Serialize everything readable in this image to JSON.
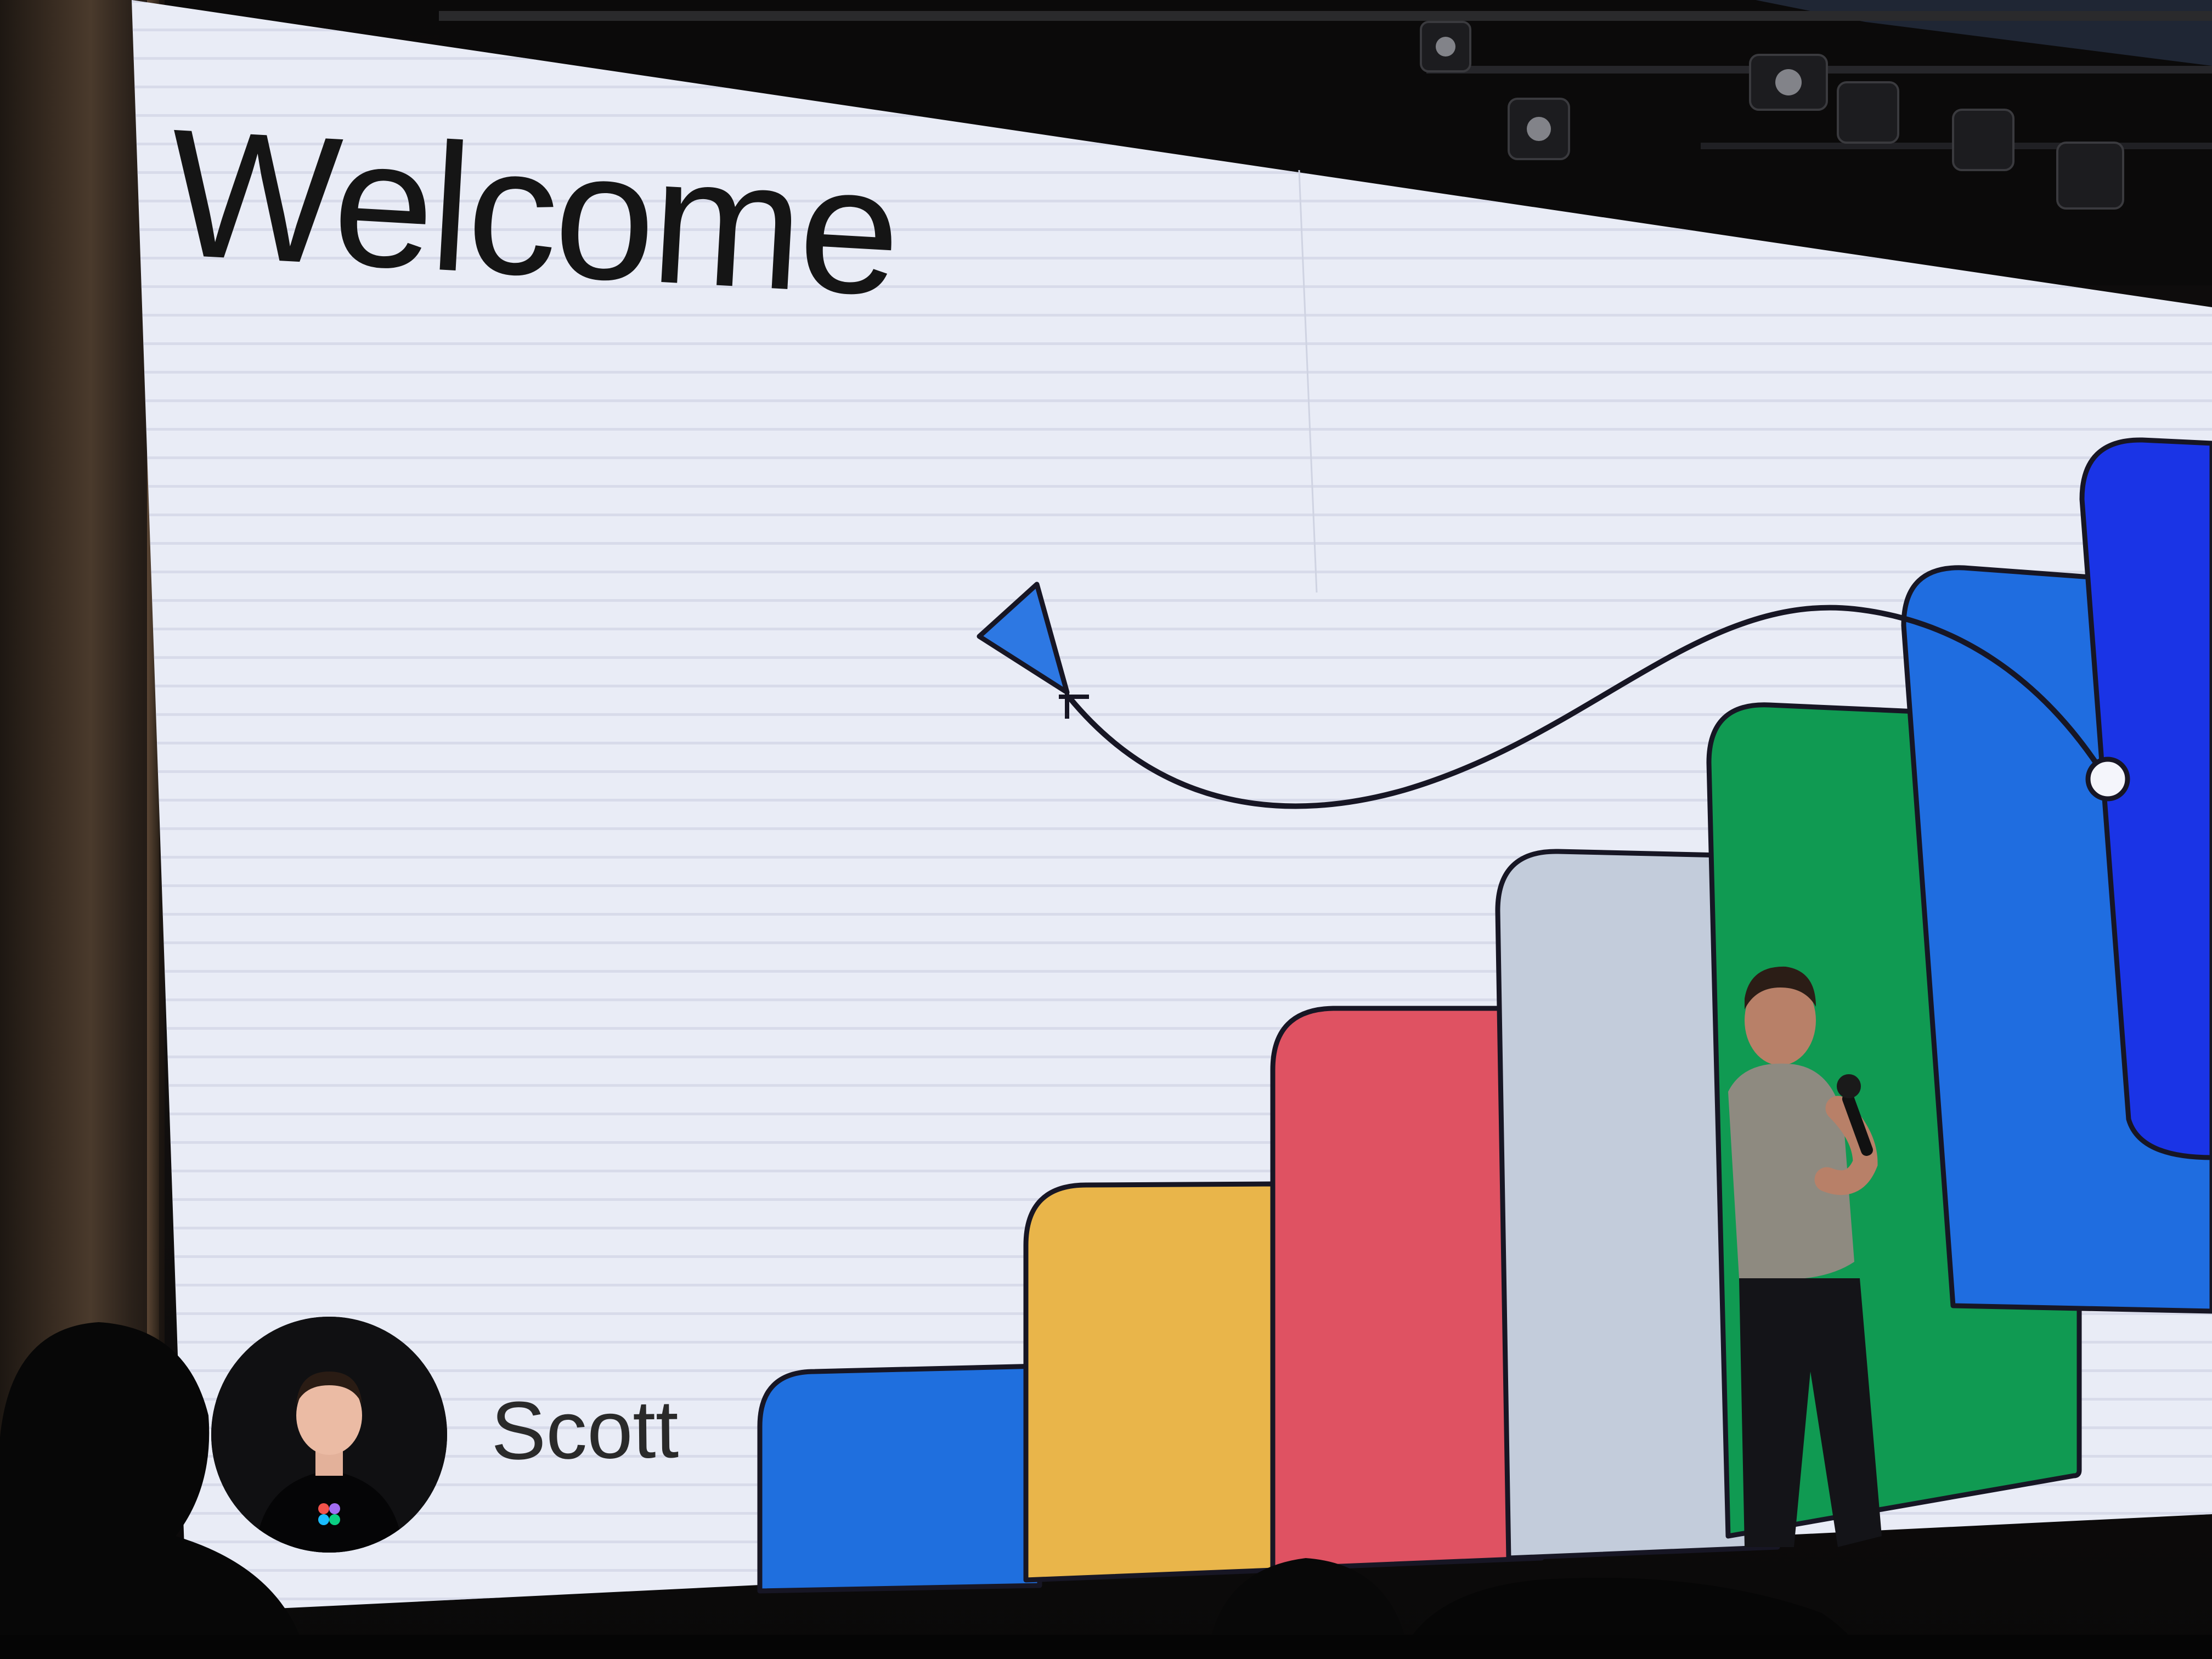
{
  "slide": {
    "title": "Welcome",
    "speaker_name": "Scott"
  },
  "colors": {
    "screen_bg": "#e9ecf6",
    "bar_blue": "#1f6fde",
    "bar_yellow": "#e9b54a",
    "bar_red": "#df5262",
    "bar_gray": "#c3ccdb",
    "bar_green": "#109a52",
    "bar_blue_2": "#1f6de0",
    "bar_indigo": "#1a34e6",
    "outline": "#171624"
  },
  "icons": {
    "cursor": "paper-plane-cursor-icon",
    "avatar": "speaker-avatar"
  }
}
